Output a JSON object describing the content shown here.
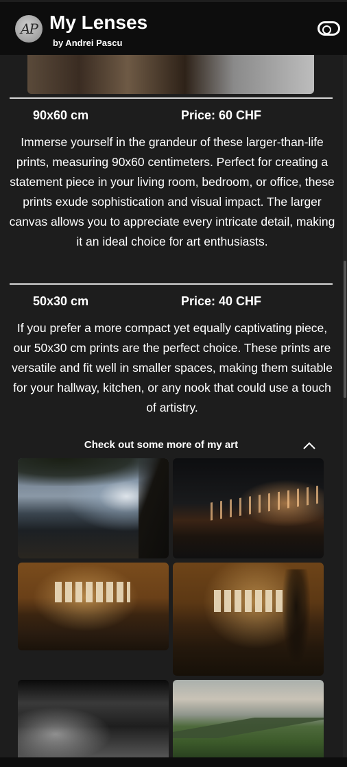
{
  "header": {
    "logo_text": "AP",
    "title": "My Lenses",
    "subtitle": "by Andrei Pascu",
    "toggle_icon": "toggle-switch-icon"
  },
  "prints": [
    {
      "size": "90x60 cm",
      "price": "Price: 60 CHF",
      "description": "Immerse yourself in the grandeur of these larger-than-life prints, measuring 90x60 centimeters. Perfect for creating a statement piece in your living room, bedroom, or office, these prints exude sophistication and visual impact. The larger canvas allows you to appreciate every intricate detail, making it an ideal choice for art enthusiasts."
    },
    {
      "size": "50x30 cm",
      "price": "Price: 40 CHF",
      "description": "If you prefer a more compact yet equally captivating piece, our 50x30 cm prints are the perfect choice. These prints are versatile and fit well in smaller spaces, making them suitable for your hallway, kitchen, or any nook that could use a touch of artistry."
    }
  ],
  "gallery": {
    "title": "Check out some more of my art",
    "collapse_icon": "chevron-up-icon"
  }
}
